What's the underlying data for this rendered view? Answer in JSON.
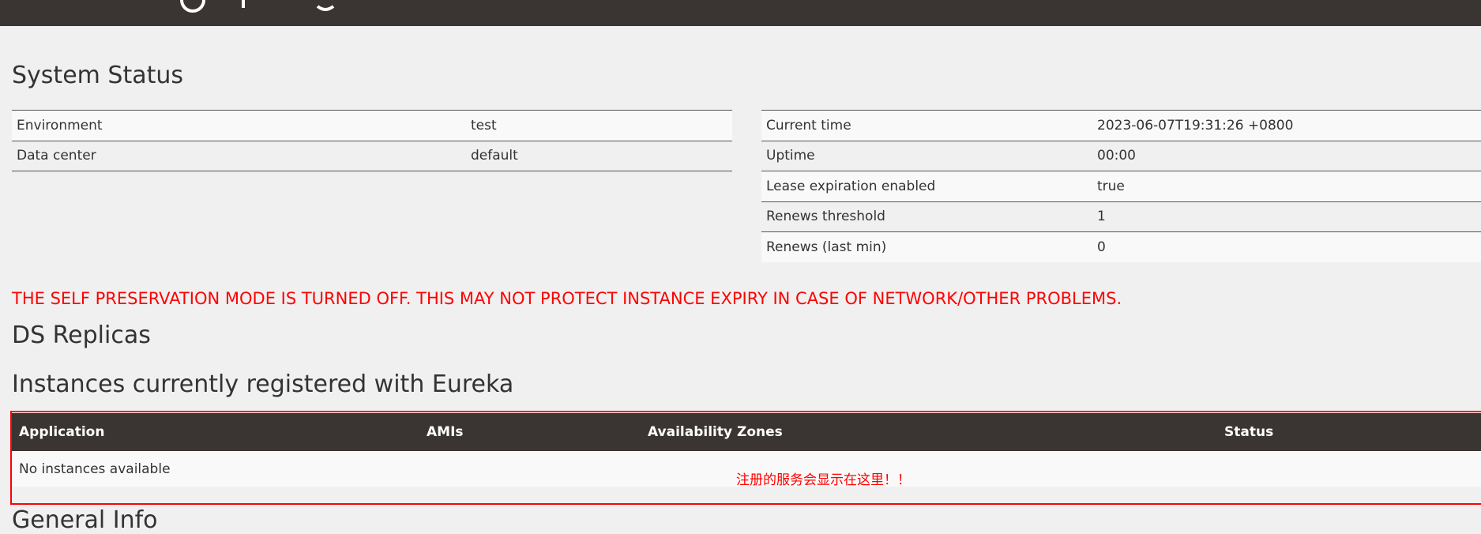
{
  "page_title": "System Status",
  "environment_table": [
    {
      "label": "Environment",
      "value": "test"
    },
    {
      "label": "Data center",
      "value": "default"
    }
  ],
  "status_table": [
    {
      "label": "Current time",
      "value": "2023-06-07T19:31:26 +0800"
    },
    {
      "label": "Uptime",
      "value": "00:00"
    },
    {
      "label": "Lease expiration enabled",
      "value": "true"
    },
    {
      "label": "Renews threshold",
      "value": "1"
    },
    {
      "label": "Renews (last min)",
      "value": "0"
    }
  ],
  "warning": "THE SELF PRESERVATION MODE IS TURNED OFF. THIS MAY NOT PROTECT INSTANCE EXPIRY IN CASE OF NETWORK/OTHER PROBLEMS.",
  "sections": {
    "ds_replicas": "DS Replicas",
    "instances": "Instances currently registered with Eureka",
    "general_info": "General Info"
  },
  "instances_table": {
    "headers": {
      "application": "Application",
      "amis": "AMIs",
      "zones": "Availability Zones",
      "status": "Status"
    },
    "empty_message": "No instances available"
  },
  "annotation": "注册的服务会显示在这里！！",
  "colors": {
    "header_bg": "#3a3532",
    "warning": "#ff0000",
    "background": "#f0f0f0"
  }
}
